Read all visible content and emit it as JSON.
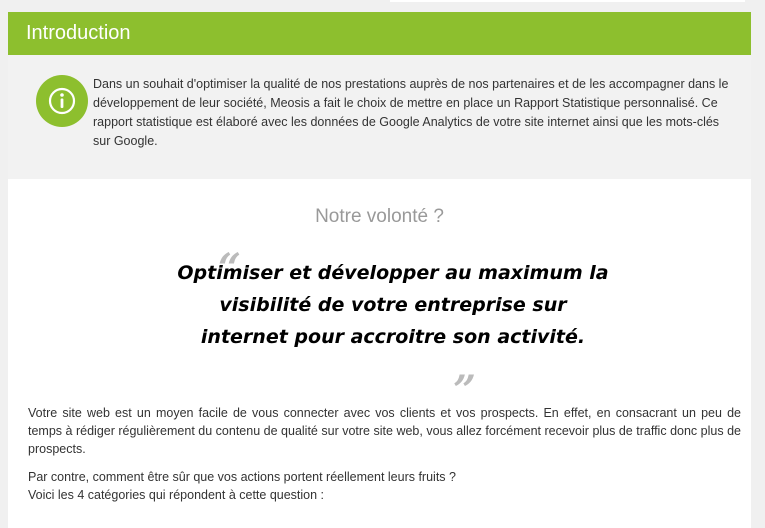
{
  "section": {
    "title": "Introduction"
  },
  "intro": {
    "icon": "info-icon",
    "text": "Dans un souhait d'optimiser la qualité de nos prestations auprès de nos partenaires et de les accompagner dans le développement de leur société, Meosis a fait le choix de mettre en place un Rapport Statistique personnalisé. Ce rapport statistique est élaboré avec les données de Google Analytics de votre site internet ainsi que les mots-clés sur Google."
  },
  "volonte": {
    "title": "Notre volonté ?",
    "quote": "Optimiser et développer au maximum la visibilité de votre entreprise sur internet pour accroitre son activité."
  },
  "body": {
    "paragraph1": "Votre site web est un moyen facile de vous connecter avec vos clients et vos prospects. En effet, en consacrant un peu de temps à rédiger régulièrement du contenu de qualité sur votre site web, vous allez forcément recevoir plus de traffic donc plus de prospects.",
    "line2": "Par contre, comment être sûr que vos actions portent réellement leurs fruits ?",
    "line3": "Voici les 4 catégories qui répondent à cette question :"
  },
  "colors": {
    "accent": "#8dbf2e"
  }
}
